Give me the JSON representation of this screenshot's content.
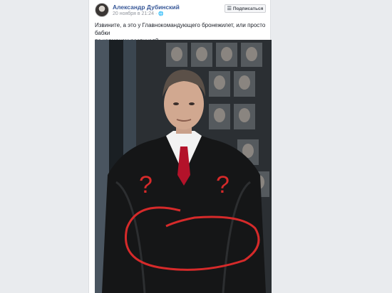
{
  "post": {
    "author": "Александр Дубинский",
    "time": "20 ноября в 21:24 · ",
    "subscribe_label": "Подписаться",
    "subscribe_icon": "rss-icon",
    "text_line1": "Извините, а это у Главнокомандующего бронежилет, или просто бабки",
    "text_line2": "по карманам распихал?",
    "photo": {
      "annotation_color": "#d62a2a",
      "annotation_marks": [
        "?",
        "?"
      ]
    }
  }
}
